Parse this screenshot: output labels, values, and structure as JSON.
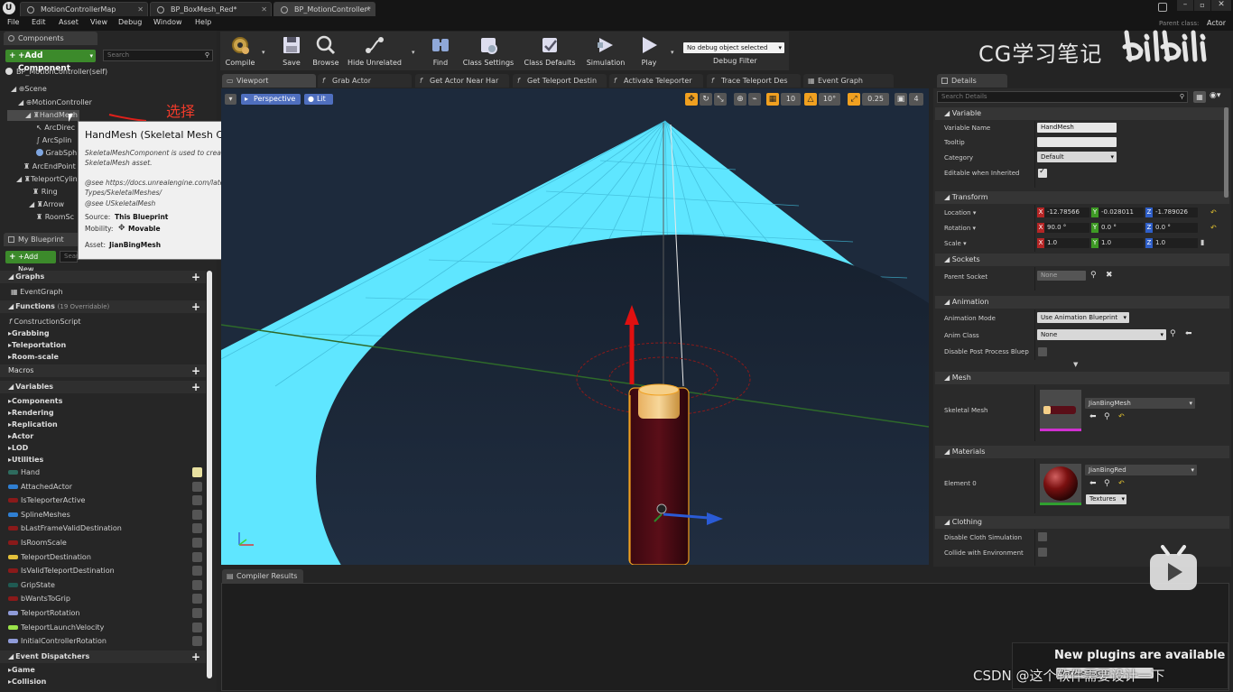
{
  "window": {
    "tabs": [
      {
        "label": "MotionControllerMap"
      },
      {
        "label": "BP_BoxMesh_Red*"
      },
      {
        "label": "BP_MotionController*"
      }
    ],
    "parent_class_label": "Parent class:",
    "parent_class_value": "Actor"
  },
  "menu": [
    "File",
    "Edit",
    "Asset",
    "View",
    "Debug",
    "Window",
    "Help"
  ],
  "components": {
    "header": "Components",
    "add_button": "+Add Component",
    "search_placeholder": "Search",
    "root": "BP_MotionController(self)",
    "items": [
      "Scene",
      "MotionController",
      "HandMesh",
      "ArcDirec",
      "ArcSplin",
      "GrabSph",
      "ArcEndPoint",
      "TeleportCylin",
      "Ring",
      "Arrow",
      "RoomSc"
    ],
    "annotation": "选择"
  },
  "tooltip": {
    "title": "HandMesh (Skeletal Mesh Component)",
    "desc1": "SkeletalMeshComponent is used to create an instance of an animated",
    "desc2": "SkeletalMesh asset.",
    "see1": "@see https://docs.unrealengine.com/latest/INT/Engine/Content/",
    "see2": "Types/SkeletalMeshes/",
    "see3": "@see USkeletalMesh",
    "source_label": "Source:",
    "source_value": "This Blueprint",
    "mobility_label": "Mobility:",
    "mobility_value": "Movable",
    "asset_label": "Asset:",
    "asset_value": "JianBingMesh"
  },
  "my_blueprint": {
    "header": "My Blueprint",
    "add_button": "+Add New",
    "search_placeholder": "Search",
    "graphs": "Graphs",
    "event_graph": "EventGraph",
    "functions": "Functions",
    "functions_count": "(19 Overridable)",
    "construction_script": "ConstructionScript",
    "function_cats": [
      "Grabbing",
      "Teleportation",
      "Room-scale"
    ],
    "macros": "Macros",
    "variables": "Variables",
    "variable_cats": [
      "Components",
      "Rendering",
      "Replication",
      "Actor",
      "LOD",
      "Utilities"
    ],
    "variables_list": [
      {
        "name": "Hand",
        "color": "#2e6b5e"
      },
      {
        "name": "AttachedActor",
        "color": "#2f7fd2"
      },
      {
        "name": "IsTeleporterActive",
        "color": "#8a1a1a"
      },
      {
        "name": "SplineMeshes",
        "color": "#2f7fd2"
      },
      {
        "name": "bLastFrameValidDestination",
        "color": "#8a1a1a"
      },
      {
        "name": "IsRoomScale",
        "color": "#8a1a1a"
      },
      {
        "name": "TeleportDestination",
        "color": "#e3c03a"
      },
      {
        "name": "IsValidTeleportDestination",
        "color": "#8a1a1a"
      },
      {
        "name": "GripState",
        "color": "#1f5a52"
      },
      {
        "name": "bWantsToGrip",
        "color": "#8a1a1a"
      },
      {
        "name": "TeleportRotation",
        "color": "#8f9bd8"
      },
      {
        "name": "TeleportLaunchVelocity",
        "color": "#9be34a"
      },
      {
        "name": "InitialControllerRotation",
        "color": "#8f9bd8"
      }
    ],
    "event_dispatchers": "Event Dispatchers",
    "dispatcher_cats": [
      "Game",
      "Collision"
    ]
  },
  "toolbar": {
    "compile": "Compile",
    "save": "Save",
    "browse": "Browse",
    "hide_unrelated": "Hide Unrelated",
    "find": "Find",
    "class_settings": "Class Settings",
    "class_defaults": "Class Defaults",
    "simulation": "Simulation",
    "play": "Play",
    "debug_select": "No debug object selected",
    "debug_filter": "Debug Filter"
  },
  "watermark": "CG学习笔记",
  "viewport_tabs": [
    "Viewport",
    "Grab Actor",
    "Get Actor Near Har",
    "Get Teleport Destin",
    "Activate Teleporter",
    "Trace Teleport Des",
    "Event Graph"
  ],
  "viewport": {
    "perspective": "Perspective",
    "lit": "Lit",
    "grid_snap": "10",
    "rot_snap": "10°",
    "scale_snap": "0.25",
    "cam_speed": "4"
  },
  "compiler_results": "Compiler Results",
  "details": {
    "header": "Details",
    "search_placeholder": "Search Details",
    "variable": {
      "title": "Variable",
      "name_label": "Variable Name",
      "name_value": "HandMesh",
      "tooltip_label": "Tooltip",
      "category_label": "Category",
      "category_value": "Default",
      "editable_label": "Editable when Inherited"
    },
    "transform": {
      "title": "Transform",
      "location_label": "Location",
      "location": [
        "-12.78566",
        "-0.028011",
        "-1.789026"
      ],
      "rotation_label": "Rotation",
      "rotation": [
        "90.0 °",
        "0.0 °",
        "0.0 °"
      ],
      "scale_label": "Scale",
      "scale": [
        "1.0",
        "1.0",
        "1.0"
      ]
    },
    "sockets": {
      "title": "Sockets",
      "parent_label": "Parent Socket",
      "parent_value": "None"
    },
    "animation": {
      "title": "Animation",
      "mode_label": "Animation Mode",
      "mode_value": "Use Animation Blueprint",
      "class_label": "Anim Class",
      "class_value": "None",
      "disable_label": "Disable Post Process Bluep"
    },
    "mesh": {
      "title": "Mesh",
      "label": "Skeletal Mesh",
      "value": "JianBingMesh"
    },
    "materials": {
      "title": "Materials",
      "label": "Element 0",
      "value": "JianBingRed",
      "textures": "Textures"
    },
    "clothing": {
      "title": "Clothing",
      "disable_label": "Disable Cloth Simulation",
      "collide_label": "Collide with Environment"
    }
  },
  "notification": "New plugins are available",
  "notification_button": "Manage Plugins",
  "footer_watermark": "CSDN @这个软件需要设计一下",
  "colors": {
    "accent_green": "#3c8a2b",
    "sky": "#5fe6ff",
    "selection": "#f0a020"
  }
}
